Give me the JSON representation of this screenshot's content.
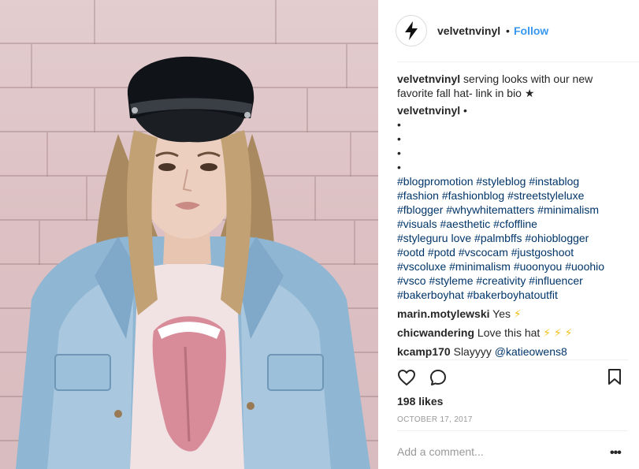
{
  "header": {
    "username": "velvetnvinyl",
    "separator": "•",
    "follow_label": "Follow",
    "avatar_icon": "lightning-bolt-icon"
  },
  "caption": {
    "username": "velvetnvinyl",
    "text": "serving looks with our new favorite fall hat- link in bio ★",
    "second_username": "velvetnvinyl",
    "second_suffix": "•",
    "bullets": [
      "•",
      "•",
      "•",
      "•"
    ],
    "hashtag_lines": [
      "#blogpromotion #styleblog #instablog",
      "#fashion #fashionblog #streetstyleluxe",
      "#fblogger #whywhitematters #minimalism",
      "#visuals #aesthetic #cfoffline",
      "#styleguru love #palmbffs #ohioblogger",
      "#ootd #potd #vscocam #justgoshoot",
      "#vscoluxe #minimalism #uoonyou #uoohio",
      "#vsco #styleme #creativity #influencer",
      "#bakerboyhat #bakerboyhatoutfit"
    ]
  },
  "comments": [
    {
      "username": "marin.motylewski",
      "text": "Yes ",
      "emoji": "⚡"
    },
    {
      "username": "chicwandering",
      "text": "Love this hat ",
      "emoji": "⚡ ⚡ ⚡"
    },
    {
      "username": "kcamp170",
      "text": "Slayyyy ",
      "mention": "@katieowens8"
    }
  ],
  "actions": {
    "like_icon": "heart-icon",
    "comment_icon": "comment-bubble-icon",
    "save_icon": "bookmark-icon"
  },
  "likes": "198 likes",
  "date": "OCTOBER 17, 2017",
  "add_comment_placeholder": "Add a comment...",
  "more_label": "•••",
  "colors": {
    "link": "#3897f0",
    "hashtag": "#003569",
    "muted": "#999999",
    "text": "#262626"
  }
}
